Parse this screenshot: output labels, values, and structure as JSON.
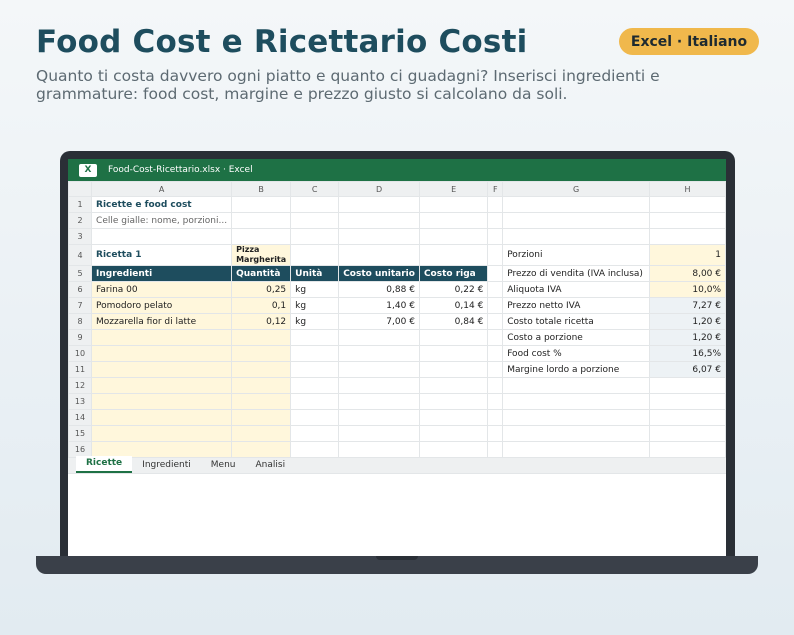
{
  "header": {
    "title": "Food Cost e Ricettario Costi",
    "badge": "Excel · Italiano",
    "subtitle": "Quanto ti costa davvero ogni piatto e quanto ci guadagni? Inserisci ingredienti e grammature: food cost, margine e prezzo giusto si calcolano da soli."
  },
  "window": {
    "app_icon": "X",
    "title": "Food-Cost-Ricettario.xlsx · Excel"
  },
  "columns": [
    "A",
    "B",
    "C",
    "D",
    "E",
    "F",
    "G",
    "H"
  ],
  "rows": [
    {
      "n": "1",
      "a": "Ricette e food cost"
    },
    {
      "n": "2",
      "a": "Celle gialle: nome, porzioni..."
    },
    {
      "n": "3"
    },
    {
      "n": "4",
      "a": "Ricetta 1",
      "b": "Pizza Margherita",
      "g": "Porzioni",
      "h": "1"
    },
    {
      "n": "5",
      "a": "Ingredienti",
      "b": "Quantità",
      "c": "Unità",
      "d": "Costo unitario",
      "e": "Costo riga",
      "g": "Prezzo di vendita (IVA inclusa)",
      "h": "8,00 €"
    },
    {
      "n": "6",
      "a": "Farina 00",
      "b": "0,25",
      "c": "kg",
      "d": "0,88 €",
      "e": "0,22 €",
      "g": "Aliquota IVA",
      "h": "10,0%"
    },
    {
      "n": "7",
      "a": "Pomodoro pelato",
      "b": "0,1",
      "c": "kg",
      "d": "1,40 €",
      "e": "0,14 €",
      "g": "Prezzo netto IVA",
      "h": "7,27 €"
    },
    {
      "n": "8",
      "a": "Mozzarella fior di latte",
      "b": "0,12",
      "c": "kg",
      "d": "7,00 €",
      "e": "0,84 €",
      "g": "Costo totale ricetta",
      "h": "1,20 €"
    },
    {
      "n": "9",
      "g": "Costo a porzione",
      "h": "1,20 €"
    },
    {
      "n": "10",
      "g": "Food cost %",
      "h": "16,5%"
    },
    {
      "n": "11",
      "g": "Margine lordo a porzione",
      "h": "6,07 €"
    },
    {
      "n": "12"
    },
    {
      "n": "13"
    },
    {
      "n": "14"
    },
    {
      "n": "15"
    },
    {
      "n": "16"
    }
  ],
  "sheet_tabs": [
    "Ricette",
    "Ingredienti",
    "Menu",
    "Analisi"
  ],
  "colors": {
    "brand": "#1e4d5e",
    "excel_green": "#1e7145",
    "badge": "#f0b84c",
    "input_yellow": "#fff7dc"
  }
}
